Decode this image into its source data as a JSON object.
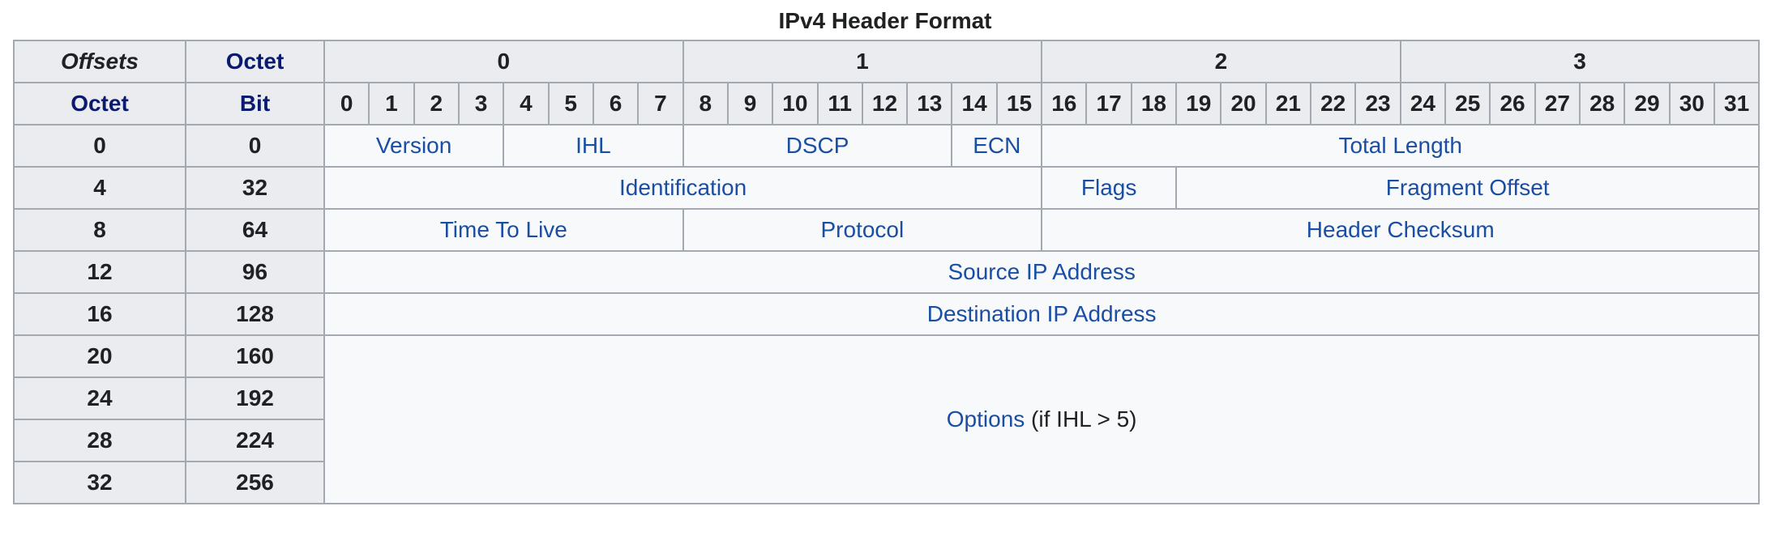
{
  "caption": "IPv4 Header Format",
  "header": {
    "offsets": "Offsets",
    "octet": "Octet",
    "octet_row2": "Octet",
    "bit": "Bit",
    "octet_numbers": [
      "0",
      "1",
      "2",
      "3"
    ],
    "bit_numbers": [
      "0",
      "1",
      "2",
      "3",
      "4",
      "5",
      "6",
      "7",
      "8",
      "9",
      "10",
      "11",
      "12",
      "13",
      "14",
      "15",
      "16",
      "17",
      "18",
      "19",
      "20",
      "21",
      "22",
      "23",
      "24",
      "25",
      "26",
      "27",
      "28",
      "29",
      "30",
      "31"
    ]
  },
  "rows": [
    {
      "octet": "0",
      "bit": "0",
      "fields": [
        {
          "label": "Version",
          "span": 4
        },
        {
          "label": "IHL",
          "span": 4
        },
        {
          "label": "DSCP",
          "span": 6
        },
        {
          "label": "ECN",
          "span": 2
        },
        {
          "label": "Total Length",
          "span": 16
        }
      ]
    },
    {
      "octet": "4",
      "bit": "32",
      "fields": [
        {
          "label": "Identification",
          "span": 16
        },
        {
          "label": "Flags",
          "span": 3
        },
        {
          "label": "Fragment Offset",
          "span": 13
        }
      ]
    },
    {
      "octet": "8",
      "bit": "64",
      "fields": [
        {
          "label": "Time To Live",
          "span": 8
        },
        {
          "label": "Protocol",
          "span": 8
        },
        {
          "label": "Header Checksum",
          "span": 16
        }
      ]
    },
    {
      "octet": "12",
      "bit": "96",
      "fields": [
        {
          "label": "Source IP Address",
          "span": 32
        }
      ]
    },
    {
      "octet": "16",
      "bit": "128",
      "fields": [
        {
          "label": "Destination IP Address",
          "span": 32
        }
      ]
    }
  ],
  "options_rows": [
    {
      "octet": "20",
      "bit": "160"
    },
    {
      "octet": "24",
      "bit": "192"
    },
    {
      "octet": "28",
      "bit": "224"
    },
    {
      "octet": "32",
      "bit": "256"
    }
  ],
  "options": {
    "label": "Options",
    "note": " (if IHL > 5)"
  }
}
